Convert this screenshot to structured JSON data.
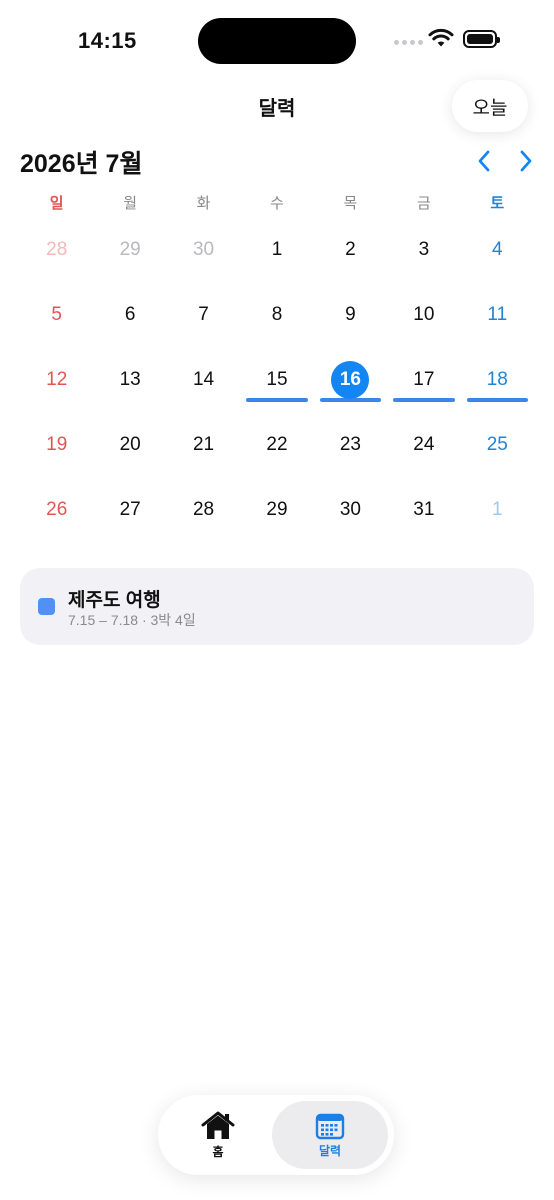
{
  "status_bar": {
    "time": "14:15"
  },
  "header": {
    "title": "달력",
    "today_button": "오늘"
  },
  "calendar": {
    "month_label": "2026년 7월",
    "weekdays": [
      "일",
      "월",
      "화",
      "수",
      "목",
      "금",
      "토"
    ],
    "weeks": [
      [
        {
          "n": "28",
          "other": true
        },
        {
          "n": "29",
          "other": true
        },
        {
          "n": "30",
          "other": true
        },
        {
          "n": "1"
        },
        {
          "n": "2"
        },
        {
          "n": "3"
        },
        {
          "n": "4"
        }
      ],
      [
        {
          "n": "5"
        },
        {
          "n": "6"
        },
        {
          "n": "7"
        },
        {
          "n": "8"
        },
        {
          "n": "9"
        },
        {
          "n": "10"
        },
        {
          "n": "11"
        }
      ],
      [
        {
          "n": "12"
        },
        {
          "n": "13"
        },
        {
          "n": "14"
        },
        {
          "n": "15",
          "event": true
        },
        {
          "n": "16",
          "today": true,
          "event": true
        },
        {
          "n": "17",
          "event": true
        },
        {
          "n": "18",
          "event": true
        }
      ],
      [
        {
          "n": "19"
        },
        {
          "n": "20"
        },
        {
          "n": "21"
        },
        {
          "n": "22"
        },
        {
          "n": "23"
        },
        {
          "n": "24"
        },
        {
          "n": "25"
        }
      ],
      [
        {
          "n": "26"
        },
        {
          "n": "27"
        },
        {
          "n": "28"
        },
        {
          "n": "29"
        },
        {
          "n": "30"
        },
        {
          "n": "31"
        },
        {
          "n": "1",
          "other": true
        }
      ]
    ]
  },
  "events": [
    {
      "title": "제주도 여행",
      "subtitle": "7.15 – 7.18 · 3박 4일",
      "color": "#5190F4"
    }
  ],
  "tab_bar": {
    "tabs": [
      {
        "label": "홈",
        "icon": "home-icon",
        "active": false
      },
      {
        "label": "달력",
        "icon": "calendar-icon",
        "active": true
      }
    ]
  },
  "colors": {
    "accent": "#1486F4",
    "sunday": "#E35555",
    "saturday": "#1F84D6",
    "event_bar": "#3B86EA"
  }
}
